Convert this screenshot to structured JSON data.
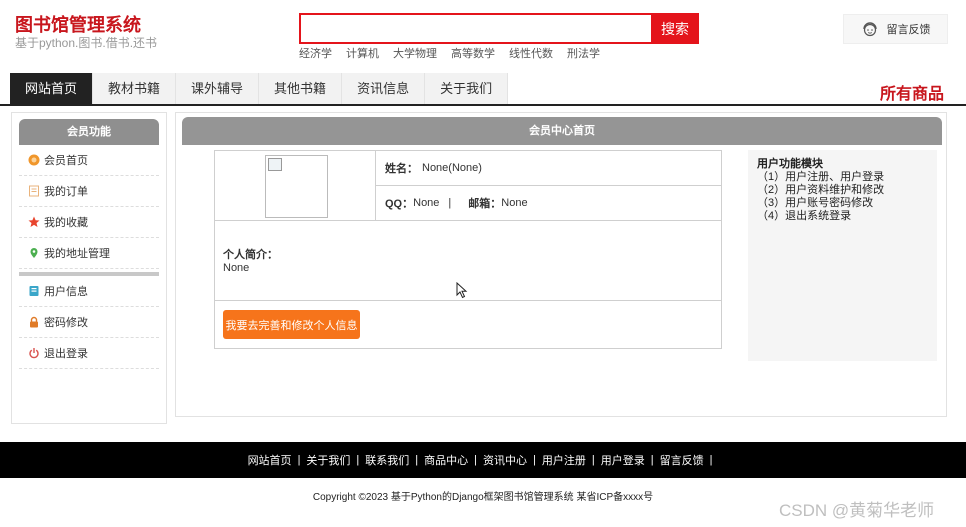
{
  "header": {
    "site_title": "图书馆管理系统",
    "site_subtitle": "基于python.图书.借书.还书",
    "search_placeholder": "",
    "search_button": "搜索",
    "hot_words": [
      "经济学",
      "计算机",
      "大学物理",
      "高等数学",
      "线性代数",
      "刑法学"
    ],
    "feedback_label": "留言反馈"
  },
  "nav": {
    "items": [
      "网站首页",
      "教材书籍",
      "课外辅导",
      "其他书籍",
      "资讯信息",
      "关于我们"
    ],
    "active_index": 0,
    "all_goods": "所有商品"
  },
  "sidebar": {
    "title": "会员功能",
    "group1": [
      {
        "label": "会员首页",
        "icon": "member-home-icon"
      },
      {
        "label": "我的订单",
        "icon": "order-icon"
      },
      {
        "label": "我的收藏",
        "icon": "star-icon"
      },
      {
        "label": "我的地址管理",
        "icon": "location-icon"
      }
    ],
    "group2": [
      {
        "label": "用户信息",
        "icon": "user-info-icon"
      },
      {
        "label": "密码修改",
        "icon": "lock-icon"
      },
      {
        "label": "退出登录",
        "icon": "power-icon"
      }
    ]
  },
  "main": {
    "title": "会员中心首页",
    "name_label": "姓名：",
    "name_value": "None(None)",
    "qq_label": "QQ：",
    "qq_value": "None",
    "email_label": "邮箱：",
    "email_value": "None",
    "bio_label": "个人简介：",
    "bio_value": "None",
    "edit_button": "我要去完善和修改个人信息"
  },
  "help": {
    "title": "用户功能模块",
    "items": [
      "（1）用户注册、用户登录",
      "（2）用户资料维护和修改",
      "（3）用户账号密码修改",
      "（4）退出系统登录"
    ]
  },
  "footer": {
    "links": [
      "网站首页",
      "关于我们",
      "联系我们",
      "商品中心",
      "资讯中心",
      "用户注册",
      "用户登录",
      "留言反馈"
    ],
    "copyright": "Copyright ©2023 基于Python的Django框架图书馆管理系统 某省ICP备xxxx号",
    "watermark": "CSDN @黄菊华老师"
  },
  "colors": {
    "brand_red": "#c8161d",
    "search_red": "#e4141b",
    "accent_orange": "#f6741b",
    "nav_active": "#222222"
  }
}
